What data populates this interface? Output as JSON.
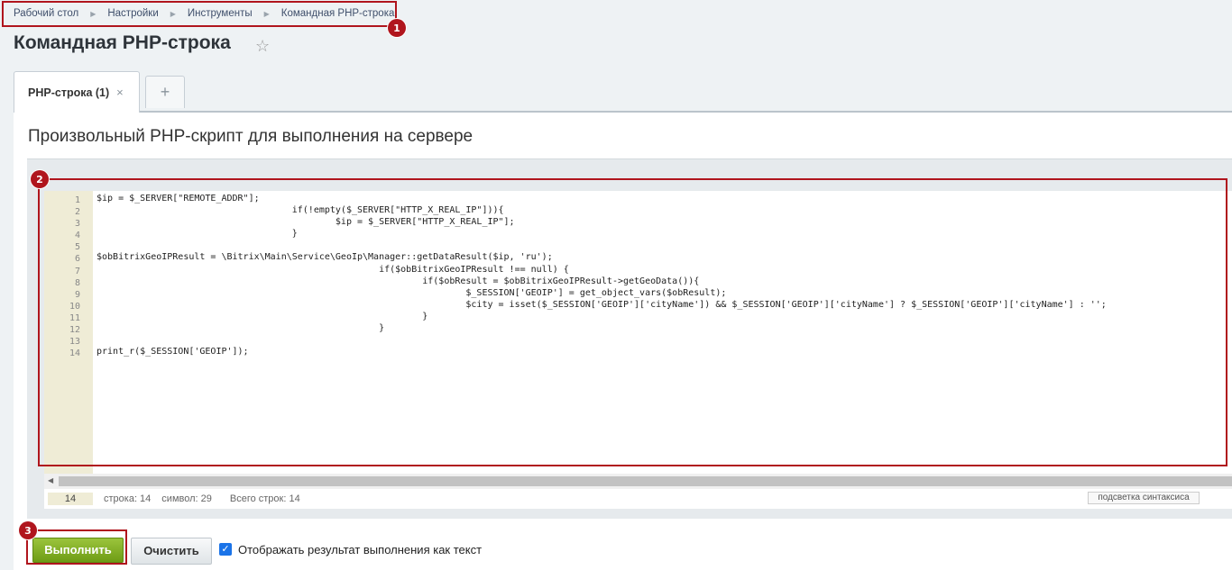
{
  "breadcrumb": [
    "Рабочий стол",
    "Настройки",
    "Инструменты",
    "Командная PHP-строка"
  ],
  "page_title": "Командная PHP-строка",
  "tabs": [
    {
      "label": "PHP-строка (1)",
      "close": "×"
    }
  ],
  "tab_add": "+",
  "section_title": "Произвольный PHP-скрипт для выполнения на сервере",
  "editor": {
    "line_numbers": [
      "1",
      "2",
      "3",
      "4",
      "5",
      "6",
      "7",
      "8",
      "9",
      "10",
      "11",
      "12",
      "13",
      "14"
    ],
    "code": "$ip = $_SERVER[\"REMOTE_ADDR\"];\n                                    if(!empty($_SERVER[\"HTTP_X_REAL_IP\"])){\n                                            $ip = $_SERVER[\"HTTP_X_REAL_IP\"];\n                                    }\n\n$obBitrixGeoIPResult = \\Bitrix\\Main\\Service\\GeoIp\\Manager::getDataResult($ip, 'ru');\n                                                    if($obBitrixGeoIPResult !== null) {\n                                                            if($obResult = $obBitrixGeoIPResult->getGeoData()){\n                                                                    $_SESSION['GEOIP'] = get_object_vars($obResult);\n                                                                    $city = isset($_SESSION['GEOIP']['cityName']) && $_SESSION['GEOIP']['cityName'] ? $_SESSION['GEOIP']['cityName'] : '';\n                                                            }\n                                                    }\n\nprint_r($_SESSION['GEOIP']);",
    "current_line": "14",
    "status_line": "строка: 14",
    "status_char": "символ: 29",
    "status_total": "Всего строк: 14",
    "syntax_toggle": "подсветка синтаксиса"
  },
  "buttons": {
    "run": "Выполнить",
    "clear": "Очистить"
  },
  "checkbox": {
    "label": "Отображать результат выполнения как текст",
    "checked": true
  },
  "annotations": [
    "1",
    "2",
    "3"
  ],
  "colors": {
    "highlight": "#b0151d",
    "run_button": "#7aa81b"
  }
}
